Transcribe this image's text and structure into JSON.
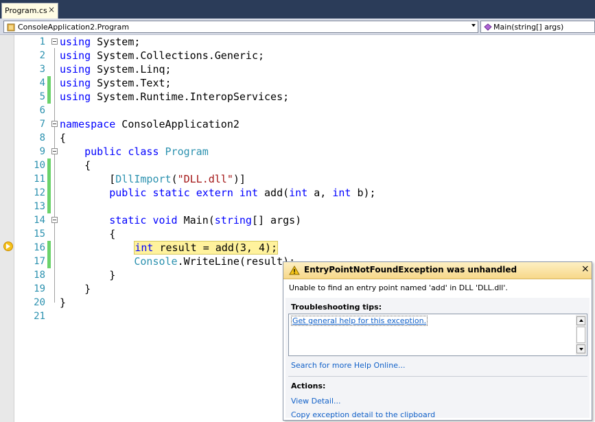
{
  "tab": {
    "label": "Program.cs",
    "close": "×"
  },
  "navbar": {
    "class_combo": "ConsoleApplication2.Program",
    "member_combo": "Main(string[] args)"
  },
  "editor": {
    "lines": [
      {
        "n": "1",
        "tokens": [
          {
            "t": "using",
            "c": "kw"
          },
          {
            "t": " System;"
          }
        ]
      },
      {
        "n": "2",
        "tokens": [
          {
            "t": "using",
            "c": "kw"
          },
          {
            "t": " System.Collections.Generic;"
          }
        ]
      },
      {
        "n": "3",
        "tokens": [
          {
            "t": "using",
            "c": "kw"
          },
          {
            "t": " System.Linq;"
          }
        ]
      },
      {
        "n": "4",
        "tokens": [
          {
            "t": "using",
            "c": "kw"
          },
          {
            "t": " System.Text;"
          }
        ]
      },
      {
        "n": "5",
        "tokens": [
          {
            "t": "using",
            "c": "kw"
          },
          {
            "t": " System.Runtime.InteropServices;"
          }
        ]
      },
      {
        "n": "6",
        "tokens": []
      },
      {
        "n": "7",
        "tokens": [
          {
            "t": "namespace",
            "c": "kw"
          },
          {
            "t": " ConsoleApplication2"
          }
        ]
      },
      {
        "n": "8",
        "tokens": [
          {
            "t": "{"
          }
        ]
      },
      {
        "n": "9",
        "tokens": [
          {
            "t": "    "
          },
          {
            "t": "public",
            "c": "kw"
          },
          {
            "t": " "
          },
          {
            "t": "class",
            "c": "kw"
          },
          {
            "t": " "
          },
          {
            "t": "Program",
            "c": "tp"
          }
        ]
      },
      {
        "n": "10",
        "tokens": [
          {
            "t": "    {"
          }
        ]
      },
      {
        "n": "11",
        "tokens": [
          {
            "t": "        ["
          },
          {
            "t": "DllImport",
            "c": "tp"
          },
          {
            "t": "("
          },
          {
            "t": "\"DLL.dll\"",
            "c": "st"
          },
          {
            "t": ")]"
          }
        ]
      },
      {
        "n": "12",
        "tokens": [
          {
            "t": "        "
          },
          {
            "t": "public",
            "c": "kw"
          },
          {
            "t": " "
          },
          {
            "t": "static",
            "c": "kw"
          },
          {
            "t": " "
          },
          {
            "t": "extern",
            "c": "kw"
          },
          {
            "t": " "
          },
          {
            "t": "int",
            "c": "kw"
          },
          {
            "t": " add("
          },
          {
            "t": "int",
            "c": "kw"
          },
          {
            "t": " a, "
          },
          {
            "t": "int",
            "c": "kw"
          },
          {
            "t": " b);"
          }
        ]
      },
      {
        "n": "13",
        "tokens": []
      },
      {
        "n": "14",
        "tokens": [
          {
            "t": "        "
          },
          {
            "t": "static",
            "c": "kw"
          },
          {
            "t": " "
          },
          {
            "t": "void",
            "c": "kw"
          },
          {
            "t": " Main("
          },
          {
            "t": "string",
            "c": "kw"
          },
          {
            "t": "[] args)"
          }
        ]
      },
      {
        "n": "15",
        "tokens": [
          {
            "t": "        {"
          }
        ]
      },
      {
        "n": "16",
        "tokens": [
          {
            "t": "            "
          },
          {
            "t": "int",
            "c": "kw"
          },
          {
            "t": " result = add(3, 4);"
          }
        ]
      },
      {
        "n": "17",
        "tokens": [
          {
            "t": "            "
          },
          {
            "t": "Console",
            "c": "tp"
          },
          {
            "t": ".WriteLine(result);"
          }
        ]
      },
      {
        "n": "18",
        "tokens": [
          {
            "t": "        }"
          }
        ]
      },
      {
        "n": "19",
        "tokens": [
          {
            "t": "    }"
          }
        ]
      },
      {
        "n": "20",
        "tokens": [
          {
            "t": "}"
          }
        ]
      },
      {
        "n": "21",
        "tokens": []
      }
    ],
    "changed_lines": [
      "4",
      "5",
      "10",
      "11",
      "12",
      "13",
      "16",
      "17"
    ],
    "fold_lines": [
      "1",
      "7",
      "9",
      "14"
    ],
    "current_line": "16"
  },
  "exception": {
    "title": "EntryPointNotFoundException was unhandled",
    "close": "×",
    "message": "Unable to find an entry point named 'add' in DLL 'DLL.dll'.",
    "tips_title": "Troubleshooting tips:",
    "tips_link": "Get general help for this exception.",
    "search_link": "Search for more Help Online...",
    "actions_title": "Actions:",
    "action_view": "View Detail...",
    "action_copy": "Copy exception detail to the clipboard"
  },
  "colors": {
    "keyword": "#0000ff",
    "type": "#2b91af",
    "string": "#a31515",
    "line_number": "#2b91af",
    "change_bar": "#6bd26b",
    "current_line_bg": "#fff29d"
  }
}
